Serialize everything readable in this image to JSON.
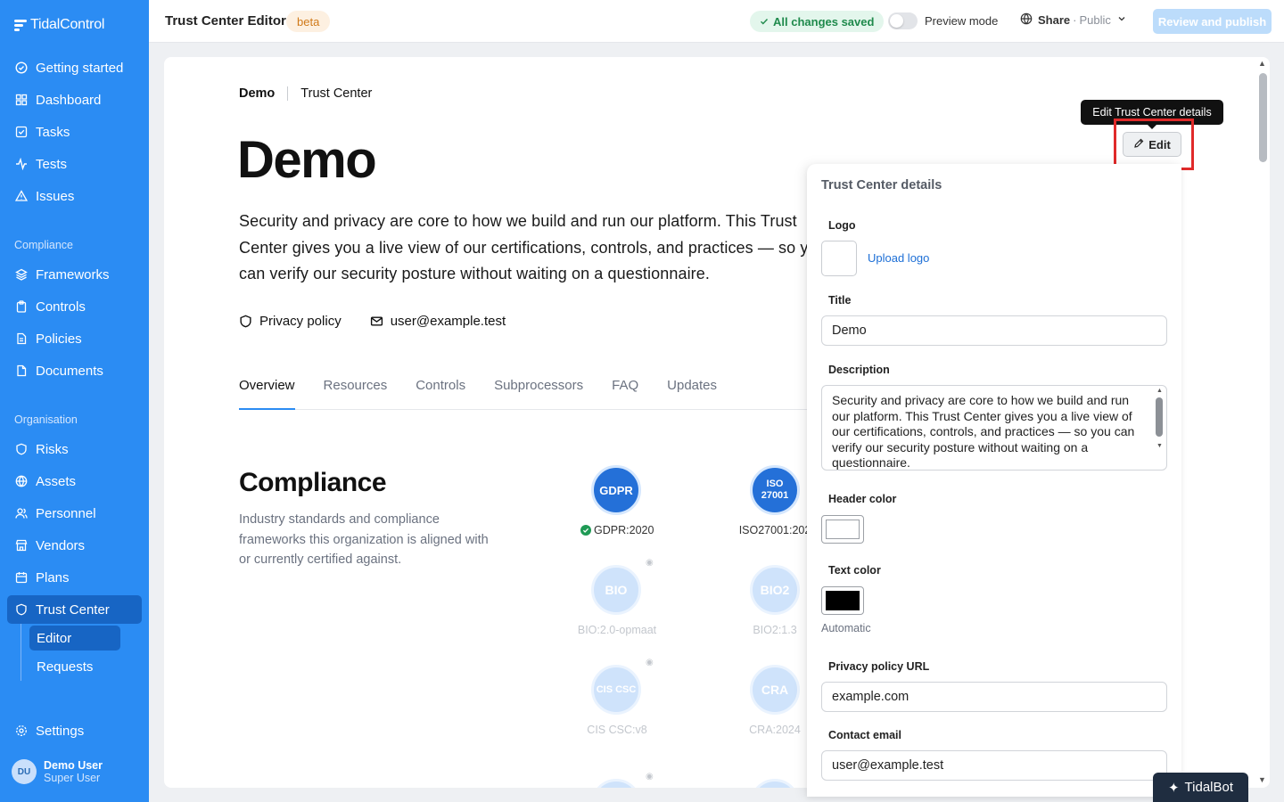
{
  "brand": {
    "name_light": "Tidal",
    "name_bold": "Control"
  },
  "nav": {
    "items": [
      {
        "label": "Getting started",
        "icon": "check-circle-icon"
      },
      {
        "label": "Dashboard",
        "icon": "grid-icon"
      },
      {
        "label": "Tasks",
        "icon": "checkbox-icon"
      },
      {
        "label": "Tests",
        "icon": "pulse-icon"
      },
      {
        "label": "Issues",
        "icon": "warning-icon"
      }
    ],
    "section_compliance": "Compliance",
    "compliance_items": [
      {
        "label": "Frameworks",
        "icon": "layers-icon"
      },
      {
        "label": "Controls",
        "icon": "clipboard-icon"
      },
      {
        "label": "Policies",
        "icon": "document-icon"
      },
      {
        "label": "Documents",
        "icon": "file-icon"
      }
    ],
    "section_organisation": "Organisation",
    "organisation_items": [
      {
        "label": "Risks",
        "icon": "shield-icon"
      },
      {
        "label": "Assets",
        "icon": "globe-icon"
      },
      {
        "label": "Personnel",
        "icon": "people-icon"
      },
      {
        "label": "Vendors",
        "icon": "store-icon"
      },
      {
        "label": "Plans",
        "icon": "calendar-icon"
      },
      {
        "label": "Trust Center",
        "icon": "shield-icon"
      }
    ],
    "sub_items": [
      {
        "label": "Editor"
      },
      {
        "label": "Requests"
      }
    ],
    "settings": "Settings"
  },
  "user": {
    "initials": "DU",
    "name": "Demo User",
    "role": "Super User"
  },
  "topbar": {
    "title": "Trust Center Editor",
    "badge": "beta",
    "saved": "All changes saved",
    "preview": "Preview mode",
    "share": "Share",
    "share_sep": " · ",
    "visibility": "Public",
    "publish": "Review and publish"
  },
  "page": {
    "crumb_org": "Demo",
    "crumb_page": "Trust Center",
    "title": "Demo",
    "description": "Security and privacy are core to how we build and run our platform. This Trust Center gives you a live view of our certifications, controls, and practices — so you can verify our security posture without waiting on a questionnaire.",
    "privacy_link": "Privacy policy",
    "email_link": "user@example.test",
    "tabs": [
      "Overview",
      "Resources",
      "Controls",
      "Subprocessors",
      "FAQ",
      "Updates"
    ],
    "compliance_title": "Compliance",
    "compliance_desc": "Industry standards and compliance frameworks this organization is aligned with or currently certified against.",
    "frameworks": [
      {
        "badge": "GDPR",
        "label": "GDPR:2020",
        "status": "active"
      },
      {
        "badge": "ISO\n27001",
        "label": "ISO27001:202",
        "status": "active"
      },
      {
        "badge": "BIO",
        "label": "BIO:2.0-opmaat",
        "status": "hidden"
      },
      {
        "badge": "BIO2",
        "label": "BIO2:1.3",
        "status": "hidden"
      },
      {
        "badge": "CIS CSC",
        "label": "CIS CSC:v8",
        "status": "hidden"
      },
      {
        "badge": "CRA",
        "label": "CRA:2024",
        "status": "hidden"
      }
    ]
  },
  "edit": {
    "tooltip": "Edit Trust Center details",
    "label": "Edit"
  },
  "panel": {
    "title": "Trust Center details",
    "logo_label": "Logo",
    "upload": "Upload logo",
    "title_label": "Title",
    "title_value": "Demo",
    "desc_label": "Description",
    "desc_value": "Security and privacy are core to how we build and run our platform. This Trust Center gives you a live view of our certifications, controls, and practices — so you can verify our security posture without waiting on a questionnaire.",
    "header_color_label": "Header color",
    "header_color": "#ffffff",
    "text_color_label": "Text color",
    "text_color": "#000000",
    "text_color_hint": "Automatic",
    "privacy_label": "Privacy policy URL",
    "privacy_value": "example.com",
    "email_label": "Contact email",
    "email_value": "user@example.test"
  },
  "bot": {
    "label": "TidalBot"
  },
  "colors": {
    "sidebar": "#2b8cf3",
    "active": "#1765c4",
    "accent": "#2b8cf3",
    "highlight": "#e02a2a"
  }
}
